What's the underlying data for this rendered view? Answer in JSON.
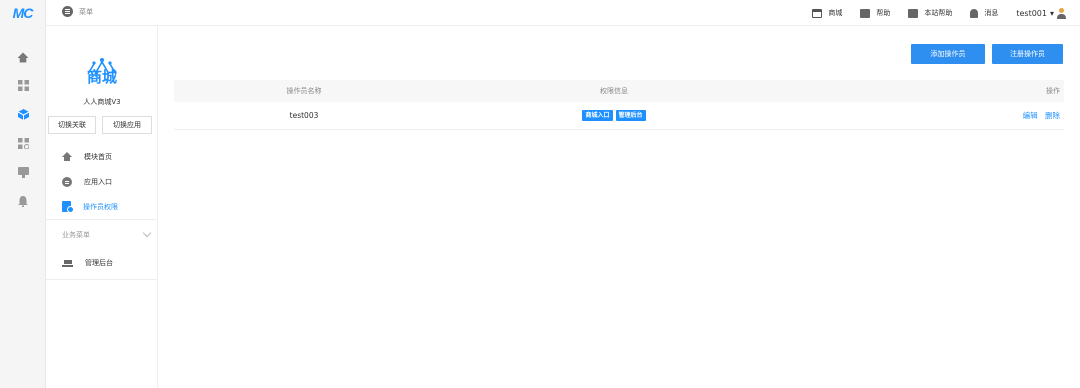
{
  "logo": "MC",
  "topbar": {
    "menu_label": "菜单",
    "links": [
      {
        "label": "商城",
        "icon": "store-icon"
      },
      {
        "label": "帮助",
        "icon": "help-icon"
      },
      {
        "label": "本站帮助",
        "icon": "site-help-icon"
      },
      {
        "label": "消息",
        "icon": "bell-icon"
      }
    ],
    "user": "test001"
  },
  "sidebar": {
    "brand_text": "商城",
    "app_name": "人人商城V3",
    "switch_left": "切换关联",
    "switch_right": "切换应用",
    "items": [
      {
        "label": "模块首页"
      },
      {
        "label": "应用入口"
      },
      {
        "label": "操作员权限"
      }
    ],
    "group_label": "业务菜单",
    "group_items": [
      {
        "label": "管理后台"
      }
    ]
  },
  "main": {
    "add_button": "添加操作员",
    "register_button": "注册操作员",
    "columns": [
      "操作员名称",
      "权限信息",
      "操作"
    ],
    "rows": [
      {
        "name": "test003",
        "tags": [
          "商城入口",
          "管理后台"
        ],
        "actions": [
          "编辑",
          "删除"
        ]
      }
    ]
  },
  "colors": {
    "accent": "#1e90ff",
    "button": "#2f8ff0"
  }
}
